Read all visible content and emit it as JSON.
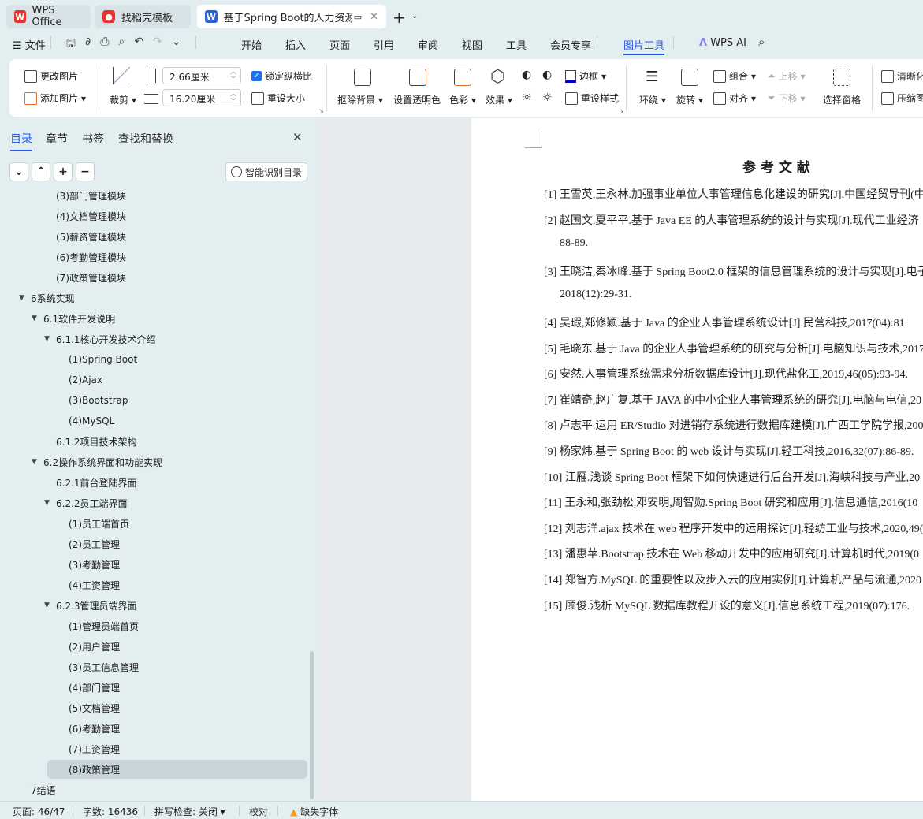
{
  "tabs": [
    {
      "label": "WPS Office",
      "icon": "wps-logo-icon"
    },
    {
      "label": "找稻壳模板",
      "icon": "docer-logo-icon"
    },
    {
      "label": "基于Spring Boot的人力资源管",
      "icon": "word-doc-icon"
    }
  ],
  "menu": {
    "file": "文件",
    "items": [
      "开始",
      "插入",
      "页面",
      "引用",
      "审阅",
      "视图",
      "工具",
      "会员专享"
    ],
    "active": "图片工具",
    "ai": "WPS AI"
  },
  "ribbon": {
    "change_picture": "更改图片",
    "add_picture": "添加图片",
    "crop": "裁剪",
    "height": "2.66厘米",
    "width": "16.20厘米",
    "lock_ratio": "锁定纵横比",
    "lock_ratio_checked": true,
    "reset_size": "重设大小",
    "remove_bg": "抠除背景",
    "set_transparent": "设置透明色",
    "color": "色彩",
    "effects": "效果",
    "border": "边框",
    "reset_style": "重设样式",
    "wrap": "环绕",
    "rotate": "旋转",
    "group": "组合",
    "align": "对齐",
    "move_up": "上移",
    "move_down": "下移",
    "selection_pane": "选择窗格",
    "clarify": "清晰化",
    "compress": "压缩图"
  },
  "sidebar": {
    "tabs": [
      "目录",
      "章节",
      "书签",
      "查找和替换"
    ],
    "active_tab": "目录",
    "smart_toc": "智能识别目录",
    "outline": [
      {
        "label": "(3)部门管理模块",
        "level": 3,
        "arrow": false
      },
      {
        "label": "(4)文档管理模块",
        "level": 3,
        "arrow": false
      },
      {
        "label": "(5)薪资管理模块",
        "level": 3,
        "arrow": false
      },
      {
        "label": "(6)考勤管理模块",
        "level": 3,
        "arrow": false
      },
      {
        "label": "(7)政策管理模块",
        "level": 3,
        "arrow": false
      },
      {
        "label": "6系统实现",
        "level": 1,
        "arrow": true
      },
      {
        "label": "6.1软件开发说明",
        "level": 2,
        "arrow": true
      },
      {
        "label": "6.1.1核心开发技术介绍",
        "level": 3,
        "arrow": true
      },
      {
        "label": "(1)Spring Boot",
        "level": 4,
        "arrow": false
      },
      {
        "label": "(2)Ajax",
        "level": 4,
        "arrow": false
      },
      {
        "label": "(3)Bootstrap",
        "level": 4,
        "arrow": false
      },
      {
        "label": "(4)MySQL",
        "level": 4,
        "arrow": false
      },
      {
        "label": "6.1.2项目技术架构",
        "level": 3,
        "arrow": false
      },
      {
        "label": "6.2操作系统界面和功能实现",
        "level": 2,
        "arrow": true
      },
      {
        "label": "6.2.1前台登陆界面",
        "level": 3,
        "arrow": false
      },
      {
        "label": "6.2.2员工端界面",
        "level": 3,
        "arrow": true
      },
      {
        "label": "(1)员工端首页",
        "level": 4,
        "arrow": false
      },
      {
        "label": "(2)员工管理",
        "level": 4,
        "arrow": false
      },
      {
        "label": "(3)考勤管理",
        "level": 4,
        "arrow": false
      },
      {
        "label": "(4)工资管理",
        "level": 4,
        "arrow": false
      },
      {
        "label": "6.2.3管理员端界面",
        "level": 3,
        "arrow": true
      },
      {
        "label": "(1)管理员端首页",
        "level": 4,
        "arrow": false
      },
      {
        "label": "(2)用户管理",
        "level": 4,
        "arrow": false
      },
      {
        "label": "(3)员工信息管理",
        "level": 4,
        "arrow": false
      },
      {
        "label": "(4)部门管理",
        "level": 4,
        "arrow": false
      },
      {
        "label": "(5)文档管理",
        "level": 4,
        "arrow": false
      },
      {
        "label": "(6)考勤管理",
        "level": 4,
        "arrow": false
      },
      {
        "label": "(7)工资管理",
        "level": 4,
        "arrow": false
      },
      {
        "label": "(8)政策管理",
        "level": 4,
        "arrow": false,
        "selected": true
      },
      {
        "label": "7结语",
        "level": 1,
        "arrow": false
      }
    ]
  },
  "document": {
    "title": "参 考 文 献",
    "lines": [
      {
        "text": "[1]  王雪英,王永林.加强事业单位人事管理信息化建设的研究[J].中国经贸导刊(中",
        "indent": false
      },
      {
        "text": "[2]  赵国文,夏平平.基于 Java  EE 的人事管理系统的设计与实现[J].现代工业经济",
        "indent": false
      },
      {
        "text": "88-89.",
        "indent": true
      },
      {
        "text": "[3]  王晓洁,秦冰峰.基于 Spring  Boot2.0 框架的信息管理系统的设计与实现[J].电子",
        "indent": false
      },
      {
        "text": "2018(12):29-31.",
        "indent": true
      },
      {
        "text": "[4]  吴瑕,郑修颖.基于 Java 的企业人事管理系统设计[J].民营科技,2017(04):81.",
        "indent": false
      },
      {
        "text": "[5]  毛晓东.基于 Java 的企业人事管理系统的研究与分析[J].电脑知识与技术,2017",
        "indent": false
      },
      {
        "text": "[6]  安然.人事管理系统需求分析数据库设计[J].现代盐化工,2019,46(05):93-94.",
        "indent": false
      },
      {
        "text": "[7]  崔靖奇,赵广复.基于 JAVA 的中小企业人事管理系统的研究[J].电脑与电信,20",
        "indent": false
      },
      {
        "text": "[8]  卢志平.运用 ER/Studio 对进销存系统进行数据库建模[J].广西工学院学报,200",
        "indent": false
      },
      {
        "text": "[9]  杨家炜.基于 Spring  Boot 的 web 设计与实现[J].轻工科技,2016,32(07):86-89.",
        "indent": false
      },
      {
        "text": "[10]  江雁.浅谈 Spring  Boot 框架下如何快速进行后台开发[J].海峡科技与产业,20",
        "indent": false
      },
      {
        "text": "[11]  王永和,张劲松,邓安明,周智勋.Spring  Boot 研究和应用[J].信息通信,2016(10",
        "indent": false
      },
      {
        "text": "[12]  刘志洋.ajax 技术在 web 程序开发中的运用探讨[J].轻纺工业与技术,2020,49(",
        "indent": false
      },
      {
        "text": "[13]  潘惠苹.Bootstrap 技术在 Web 移动开发中的应用研究[J].计算机时代,2019(0",
        "indent": false
      },
      {
        "text": "[14]  郑智方.MySQL 的重要性以及步入云的应用实例[J].计算机产品与流通,2020",
        "indent": false
      },
      {
        "text": "[15]  顾俊.浅析 MySQL 数据库教程开设的意义[J].信息系统工程,2019(07):176.",
        "indent": false
      }
    ]
  },
  "status": {
    "page": "页面: 46/47",
    "words": "字数: 16436",
    "spell": "拼写检查: 关闭",
    "proof": "校对",
    "missing_font": "缺失字体"
  },
  "colors": {
    "accent": "#2458e6",
    "sidebar_bg": "#e3eef0",
    "selected_row": "#c9d5da",
    "warning": "#f0a020"
  }
}
